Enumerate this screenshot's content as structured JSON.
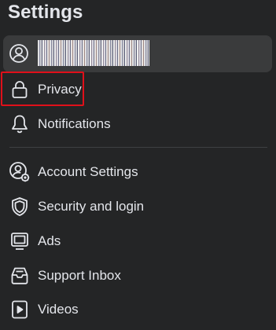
{
  "header": {
    "title": "Settings"
  },
  "profile": {
    "icon": "user-circle-icon",
    "name_redacted": true
  },
  "menu": {
    "items": [
      {
        "label": "Privacy",
        "icon": "lock-icon",
        "highlighted": true
      },
      {
        "label": "Notifications",
        "icon": "bell-icon"
      },
      {
        "label": "Account Settings",
        "icon": "user-gear-icon"
      },
      {
        "label": "Security and login",
        "icon": "shield-icon"
      },
      {
        "label": "Ads",
        "icon": "monitor-icon"
      },
      {
        "label": "Support Inbox",
        "icon": "inbox-icon"
      },
      {
        "label": "Videos",
        "icon": "video-icon"
      }
    ]
  },
  "colors": {
    "background": "#242526",
    "text": "#e4e6eb",
    "profile_row_bg": "#3a3b3c",
    "highlight_border": "#e0101a",
    "divider": "#3e4042"
  }
}
